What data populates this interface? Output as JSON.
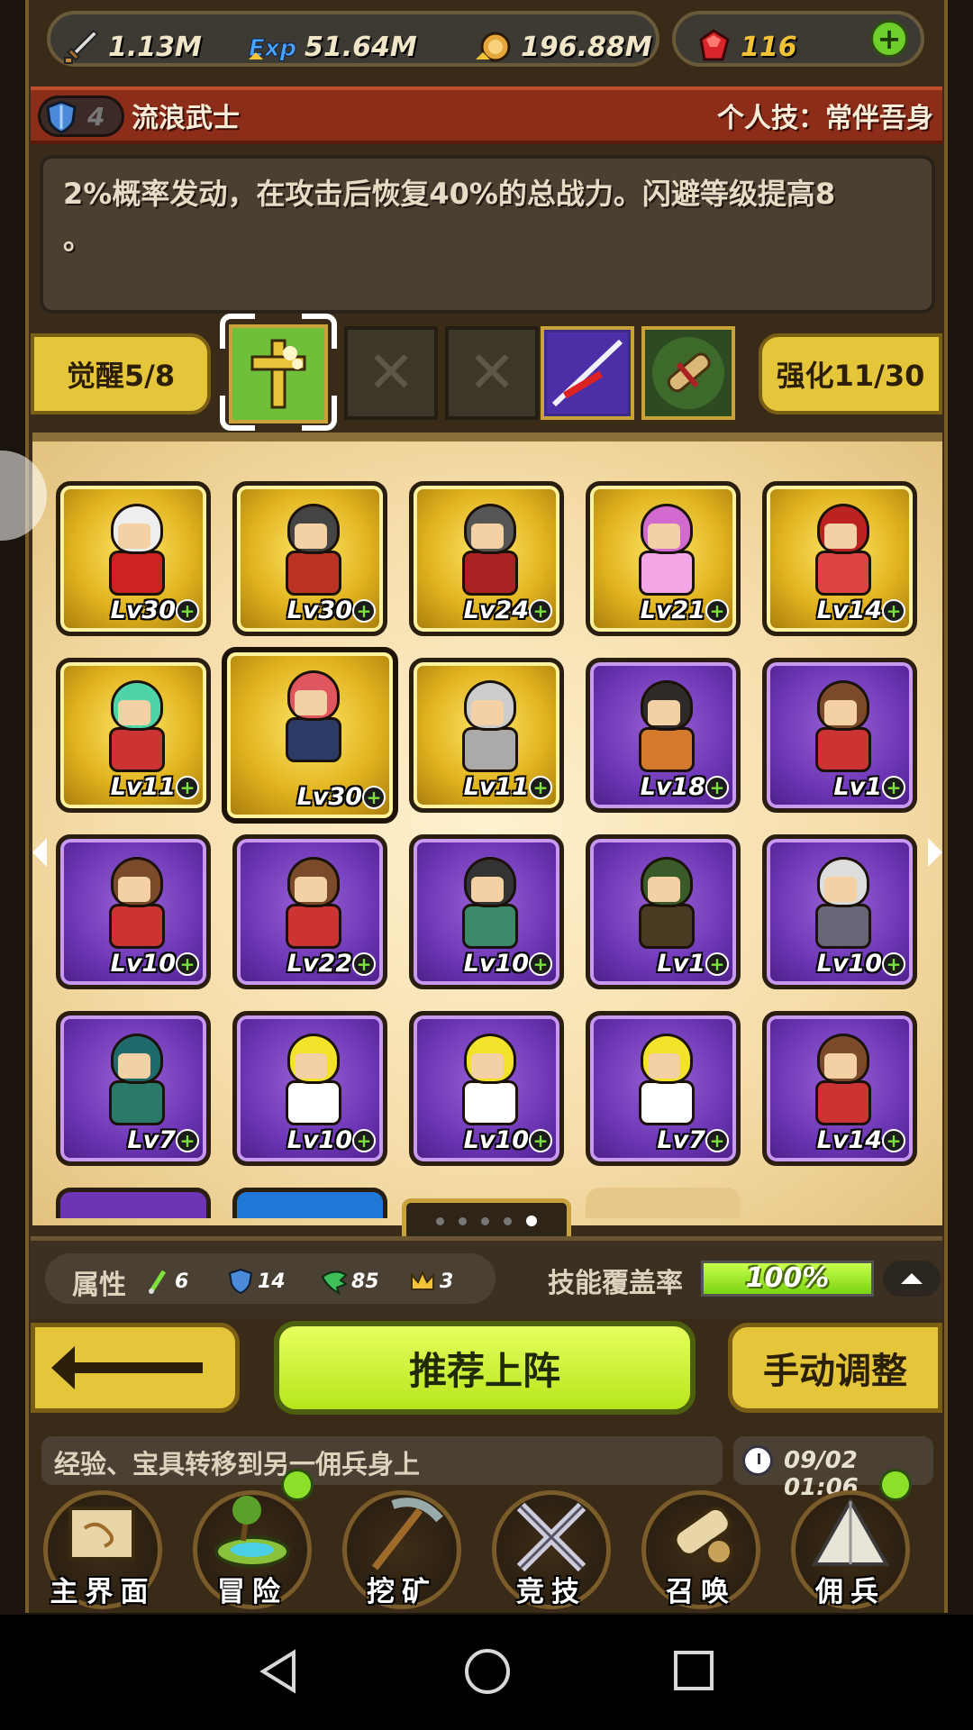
{
  "resources": {
    "attack": {
      "icon": "sword-icon",
      "value": "1.13M"
    },
    "exp": {
      "icon": "exp-icon",
      "value": "51.64M"
    },
    "gold": {
      "icon": "coin-icon",
      "value": "196.88M"
    },
    "gems": {
      "icon": "ruby-icon",
      "value": "116"
    }
  },
  "hero": {
    "rank": "4",
    "name": "流浪武士",
    "skill": "个人技：常伴吾身",
    "description_line1": "2%概率发动，在攻击后恢复40%的总战力。闪避等级提高8",
    "description_line2": "。"
  },
  "equip": {
    "awaken_label": "觉醒5/8",
    "enhance_label": "强化11/30",
    "empty_mark": "✕"
  },
  "mercenaries": [
    {
      "level": "Lv30",
      "rarity": "gold",
      "hair": "#eee",
      "cloth": "#c22"
    },
    {
      "level": "Lv30",
      "rarity": "gold",
      "hair": "#444",
      "cloth": "#b32"
    },
    {
      "level": "Lv24",
      "rarity": "gold",
      "hair": "#555",
      "cloth": "#a22"
    },
    {
      "level": "Lv21",
      "rarity": "gold",
      "hair": "#d36ad0",
      "cloth": "#f2a6e6"
    },
    {
      "level": "Lv14",
      "rarity": "gold",
      "hair": "#b22",
      "cloth": "#d44"
    },
    {
      "level": "Lv11",
      "rarity": "gold",
      "hair": "#4fd3a8",
      "cloth": "#c33"
    },
    {
      "level": "Lv30",
      "rarity": "gold",
      "hair": "#e0565e",
      "cloth": "#2c3a66",
      "selected": true
    },
    {
      "level": "Lv11",
      "rarity": "gold",
      "hair": "#ccc",
      "cloth": "#aaa"
    },
    {
      "level": "Lv18",
      "rarity": "purple",
      "hair": "#2e2a28",
      "cloth": "#d47a2c"
    },
    {
      "level": "Lv1",
      "rarity": "purple",
      "hair": "#7a4a2a",
      "cloth": "#c33"
    },
    {
      "level": "Lv10",
      "rarity": "purple",
      "hair": "#7a4a2a",
      "cloth": "#c33"
    },
    {
      "level": "Lv22",
      "rarity": "purple",
      "hair": "#7a4a2a",
      "cloth": "#c33"
    },
    {
      "level": "Lv10",
      "rarity": "purple",
      "hair": "#333",
      "cloth": "#3a8a6a"
    },
    {
      "level": "Lv1",
      "rarity": "purple",
      "hair": "#3b5a2a",
      "cloth": "#4a3a22"
    },
    {
      "level": "Lv10",
      "rarity": "purple",
      "hair": "#ddd",
      "cloth": "#667"
    },
    {
      "level": "Lv7",
      "rarity": "purple",
      "hair": "#1f6a6a",
      "cloth": "#2a7a6a"
    },
    {
      "level": "Lv10",
      "rarity": "purple",
      "hair": "#f2e22a",
      "cloth": "#fff"
    },
    {
      "level": "Lv10",
      "rarity": "purple",
      "hair": "#f2e22a",
      "cloth": "#fff"
    },
    {
      "level": "Lv7",
      "rarity": "purple",
      "hair": "#f2e22a",
      "cloth": "#fff"
    },
    {
      "level": "Lv14",
      "rarity": "purple",
      "hair": "#7a4a2a",
      "cloth": "#c33"
    }
  ],
  "pager": {
    "pages": 5,
    "current": 5
  },
  "stats": {
    "label": "属性",
    "strength": "6",
    "defense": "14",
    "agility": "85",
    "leadership": "3",
    "coverage_label": "技能覆盖率",
    "coverage_value": "100%",
    "coverage_fraction": 1.0
  },
  "actions": {
    "recommend": "推荐上阵",
    "manual": "手动调整"
  },
  "message": {
    "text": "经验、宝具转移到另一佣兵身上",
    "time": "09/02 01:06"
  },
  "nav": [
    {
      "label": "主界面",
      "icon": "scroll-map-icon",
      "badge": false
    },
    {
      "label": "冒险",
      "icon": "island-icon",
      "badge": true
    },
    {
      "label": "挖矿",
      "icon": "pickaxe-icon",
      "badge": false
    },
    {
      "label": "竞技",
      "icon": "crossed-swords-icon",
      "badge": false
    },
    {
      "label": "召唤",
      "icon": "summon-scroll-icon",
      "badge": false
    },
    {
      "label": "佣兵",
      "icon": "tent-icon",
      "badge": true
    }
  ],
  "colors": {
    "gold": "#e5c63a",
    "purple": "#6c35b4",
    "accent_green": "#b7e61c",
    "header_red": "#8c2d1a"
  }
}
